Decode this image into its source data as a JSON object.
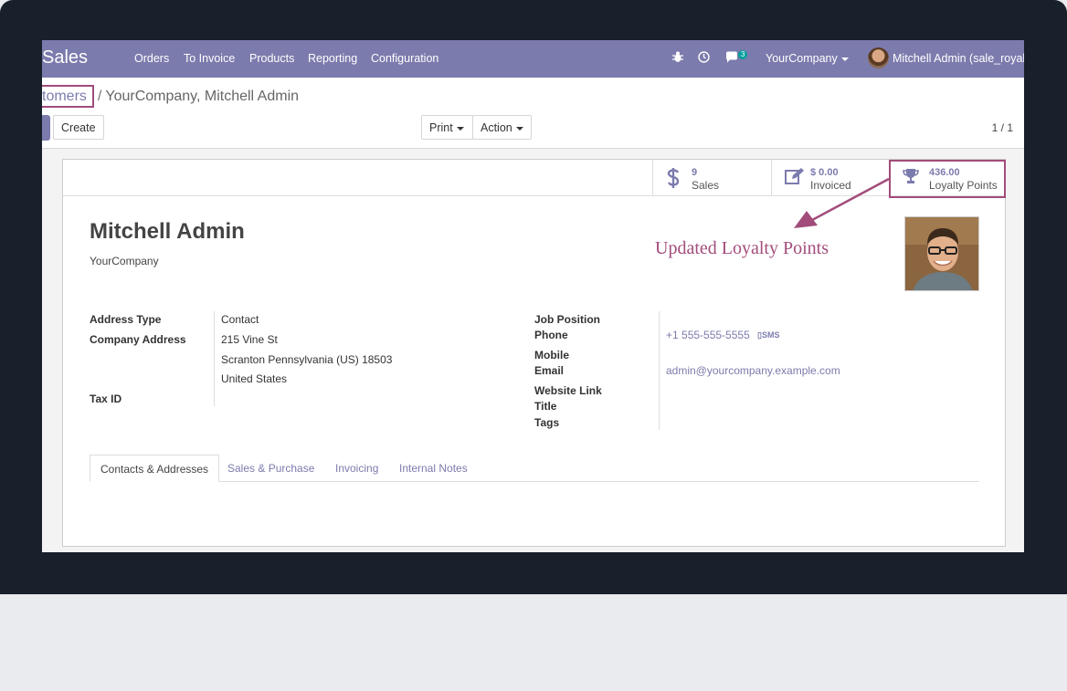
{
  "navbar": {
    "app_name": "Sales",
    "menu": [
      "Orders",
      "To Invoice",
      "Products",
      "Reporting",
      "Configuration"
    ],
    "message_count": "3",
    "company": "YourCompany",
    "user": "Mitchell Admin (sale_royalty"
  },
  "breadcrumb": {
    "parent": "tomers",
    "separator": "/",
    "current": "YourCompany, Mitchell Admin"
  },
  "toolbar": {
    "create_label": "Create",
    "print_label": "Print",
    "action_label": "Action",
    "pager": "1 / 1"
  },
  "stat_buttons": [
    {
      "value": "9",
      "label": "Sales",
      "icon": "dollar-icon"
    },
    {
      "value": "$ 0.00",
      "label": "Invoiced",
      "icon": "pencil-square-icon"
    },
    {
      "value": "436.00",
      "label": "Loyalty Points",
      "icon": "trophy-icon"
    }
  ],
  "annotation": {
    "text": "Updated Loyalty Points",
    "color": "#a24c7b"
  },
  "partner": {
    "name": "Mitchell Admin",
    "company": "YourCompany"
  },
  "left_fields": {
    "address_type_label": "Address Type",
    "address_type_value": "Contact",
    "company_address_label": "Company Address",
    "street": "215 Vine St",
    "city_line": "Scranton  Pennsylvania (US)  18503",
    "country": "United States",
    "tax_id_label": "Tax ID"
  },
  "right_fields": {
    "job_position_label": "Job Position",
    "phone_label": "Phone",
    "phone_value": "+1 555-555-5555",
    "sms_label": "SMS",
    "mobile_label": "Mobile",
    "email_label": "Email",
    "email_value": "admin@yourcompany.example.com",
    "website_label": "Website Link",
    "title_label": "Title",
    "tags_label": "Tags"
  },
  "tabs": [
    "Contacts & Addresses",
    "Sales & Purchase",
    "Invoicing",
    "Internal Notes"
  ],
  "colors": {
    "brand": "#7c7bad",
    "highlight": "#a24c7b"
  }
}
